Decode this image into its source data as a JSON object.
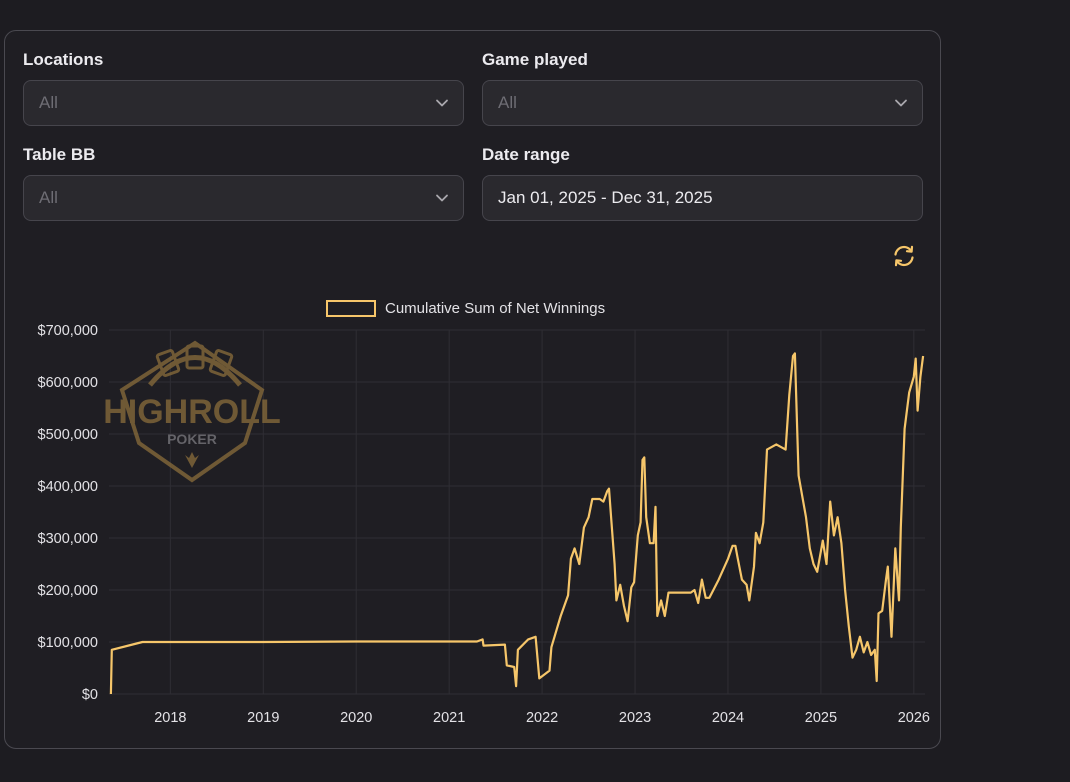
{
  "filters": {
    "locations": {
      "label": "Locations",
      "value": "All"
    },
    "game_played": {
      "label": "Game played",
      "value": "All"
    },
    "table_bb": {
      "label": "Table BB",
      "value": "All"
    },
    "date_range": {
      "label": "Date range",
      "value": "Jan 01, 2025 - Dec 31, 2025"
    }
  },
  "icons": {
    "dropdown": "chevron-down-icon",
    "refresh": "refresh-icon"
  },
  "colors": {
    "line": "#f6c66a",
    "accent": "#f6c66a",
    "logo": "#8a6d3b"
  },
  "watermark": {
    "text_main": "HIGHROLL",
    "text_sub": "POKER"
  },
  "chart_data": {
    "type": "line",
    "title": "",
    "xlabel": "",
    "ylabel": "",
    "legend": "top-center",
    "grid": true,
    "x_ticks": [
      "2018",
      "2019",
      "2020",
      "2021",
      "2022",
      "2023",
      "2024",
      "2025",
      "2026"
    ],
    "y_ticks": [
      "$0",
      "$100,000",
      "$200,000",
      "$300,000",
      "$400,000",
      "$500,000",
      "$600,000",
      "$700,000"
    ],
    "ylim": [
      0,
      700000
    ],
    "xlim": [
      2017.34,
      2026.12
    ],
    "series": [
      {
        "name": "Cumulative Sum of Net Winnings",
        "points": [
          [
            2017.36,
            0
          ],
          [
            2017.37,
            85000
          ],
          [
            2017.7,
            100000
          ],
          [
            2019.0,
            100000
          ],
          [
            2020.0,
            101000
          ],
          [
            2021.3,
            101000
          ],
          [
            2021.36,
            105000
          ],
          [
            2021.37,
            93000
          ],
          [
            2021.6,
            95000
          ],
          [
            2021.62,
            55000
          ],
          [
            2021.7,
            52000
          ],
          [
            2021.72,
            15000
          ],
          [
            2021.74,
            85000
          ],
          [
            2021.85,
            105000
          ],
          [
            2021.93,
            110000
          ],
          [
            2021.97,
            30000
          ],
          [
            2022.08,
            45000
          ],
          [
            2022.1,
            90000
          ],
          [
            2022.2,
            150000
          ],
          [
            2022.28,
            190000
          ],
          [
            2022.31,
            260000
          ],
          [
            2022.35,
            280000
          ],
          [
            2022.4,
            250000
          ],
          [
            2022.45,
            320000
          ],
          [
            2022.5,
            340000
          ],
          [
            2022.54,
            375000
          ],
          [
            2022.62,
            375000
          ],
          [
            2022.66,
            370000
          ],
          [
            2022.7,
            390000
          ],
          [
            2022.72,
            395000
          ],
          [
            2022.74,
            345000
          ],
          [
            2022.78,
            250000
          ],
          [
            2022.8,
            180000
          ],
          [
            2022.84,
            210000
          ],
          [
            2022.88,
            170000
          ],
          [
            2022.92,
            140000
          ],
          [
            2022.96,
            205000
          ],
          [
            2022.99,
            215000
          ],
          [
            2023.03,
            305000
          ],
          [
            2023.06,
            330000
          ],
          [
            2023.08,
            450000
          ],
          [
            2023.1,
            455000
          ],
          [
            2023.12,
            340000
          ],
          [
            2023.16,
            290000
          ],
          [
            2023.2,
            290000
          ],
          [
            2023.22,
            360000
          ],
          [
            2023.24,
            150000
          ],
          [
            2023.28,
            180000
          ],
          [
            2023.32,
            150000
          ],
          [
            2023.36,
            195000
          ],
          [
            2023.6,
            195000
          ],
          [
            2023.64,
            200000
          ],
          [
            2023.68,
            175000
          ],
          [
            2023.72,
            220000
          ],
          [
            2023.76,
            185000
          ],
          [
            2023.8,
            185000
          ],
          [
            2023.9,
            220000
          ],
          [
            2024.0,
            260000
          ],
          [
            2024.05,
            285000
          ],
          [
            2024.08,
            285000
          ],
          [
            2024.1,
            265000
          ],
          [
            2024.15,
            220000
          ],
          [
            2024.2,
            210000
          ],
          [
            2024.23,
            180000
          ],
          [
            2024.28,
            245000
          ],
          [
            2024.3,
            310000
          ],
          [
            2024.34,
            290000
          ],
          [
            2024.38,
            330000
          ],
          [
            2024.42,
            470000
          ],
          [
            2024.52,
            480000
          ],
          [
            2024.62,
            470000
          ],
          [
            2024.66,
            575000
          ],
          [
            2024.7,
            650000
          ],
          [
            2024.72,
            655000
          ],
          [
            2024.74,
            540000
          ],
          [
            2024.76,
            420000
          ],
          [
            2024.8,
            380000
          ],
          [
            2024.84,
            340000
          ],
          [
            2024.88,
            280000
          ],
          [
            2024.92,
            250000
          ],
          [
            2024.96,
            235000
          ],
          [
            2025.02,
            295000
          ],
          [
            2025.06,
            250000
          ],
          [
            2025.1,
            370000
          ],
          [
            2025.14,
            305000
          ],
          [
            2025.18,
            340000
          ],
          [
            2025.22,
            290000
          ],
          [
            2025.26,
            200000
          ],
          [
            2025.3,
            130000
          ],
          [
            2025.34,
            70000
          ],
          [
            2025.38,
            85000
          ],
          [
            2025.42,
            110000
          ],
          [
            2025.46,
            80000
          ],
          [
            2025.5,
            100000
          ],
          [
            2025.54,
            75000
          ],
          [
            2025.58,
            85000
          ],
          [
            2025.6,
            25000
          ],
          [
            2025.62,
            155000
          ],
          [
            2025.66,
            160000
          ],
          [
            2025.7,
            220000
          ],
          [
            2025.72,
            245000
          ],
          [
            2025.76,
            110000
          ],
          [
            2025.8,
            280000
          ],
          [
            2025.84,
            180000
          ],
          [
            2025.86,
            320000
          ],
          [
            2025.9,
            510000
          ],
          [
            2025.95,
            580000
          ],
          [
            2026.0,
            610000
          ],
          [
            2026.02,
            645000
          ],
          [
            2026.04,
            545000
          ],
          [
            2026.07,
            610000
          ],
          [
            2026.1,
            650000
          ]
        ]
      }
    ]
  }
}
